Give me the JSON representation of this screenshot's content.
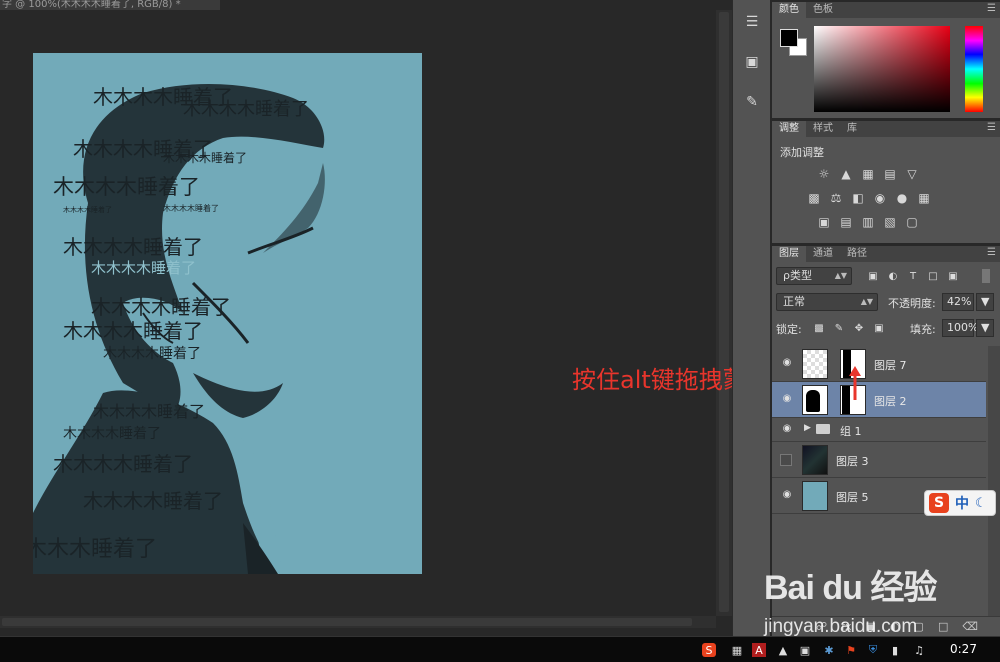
{
  "document": {
    "tab_title": "字 @ 100%(木木木木睡着了, RGB/8) *"
  },
  "portrait_text": [
    "木木木木睡着了",
    "木木木木睡着了",
    "木木木木睡着了",
    "木木木木睡着了",
    "木木木木睡着了",
    "木木木木睡着了",
    "木木木木睡着了",
    "木木木木睡着了",
    "木木木木睡着了",
    "木木木木睡着了",
    "木木木木睡着了",
    "木木木木睡着了",
    "木木木木睡着了",
    "木木木木睡着了",
    "木木木木睡着了",
    "木木木木睡着了",
    "木木木木睡着了"
  ],
  "annotation": "按住alt键拖拽蒙版",
  "tool_strip": {
    "icons": [
      "properties-icon",
      "3d-cube-icon",
      "measure-icon"
    ]
  },
  "color_panel": {
    "tabs": [
      "颜色",
      "色板"
    ],
    "colors": {
      "foreground": "#000000",
      "background": "#ffffff"
    }
  },
  "adjustments_panel": {
    "tabs": [
      "调整",
      "样式",
      "库"
    ],
    "title": "添加调整"
  },
  "layers_panel": {
    "tabs": [
      "图层",
      "通道",
      "路径"
    ],
    "filter_kind": "ρ类型",
    "blend_mode": "正常",
    "opacity_label": "不透明度:",
    "opacity_value": "42%",
    "lock_label": "锁定:",
    "fill_label": "填充:",
    "fill_value": "100%",
    "layers": [
      {
        "name": "图层 7",
        "visible": true,
        "selected": false
      },
      {
        "name": "图层 2",
        "visible": true,
        "selected": true
      },
      {
        "name": "组 1",
        "visible": true,
        "selected": false
      },
      {
        "name": "图层 3",
        "visible": false,
        "selected": false
      },
      {
        "name": "图层 5",
        "visible": true,
        "selected": false
      }
    ],
    "colors": {
      "selected_row": "#6d84a8",
      "layer5_fill": "#72aab9"
    }
  },
  "ime": {
    "mode": "中"
  },
  "watermark": {
    "brand": "Bai du 经验",
    "url": "jingyan.baidu.com"
  },
  "taskbar": {
    "clock": "0:27"
  }
}
